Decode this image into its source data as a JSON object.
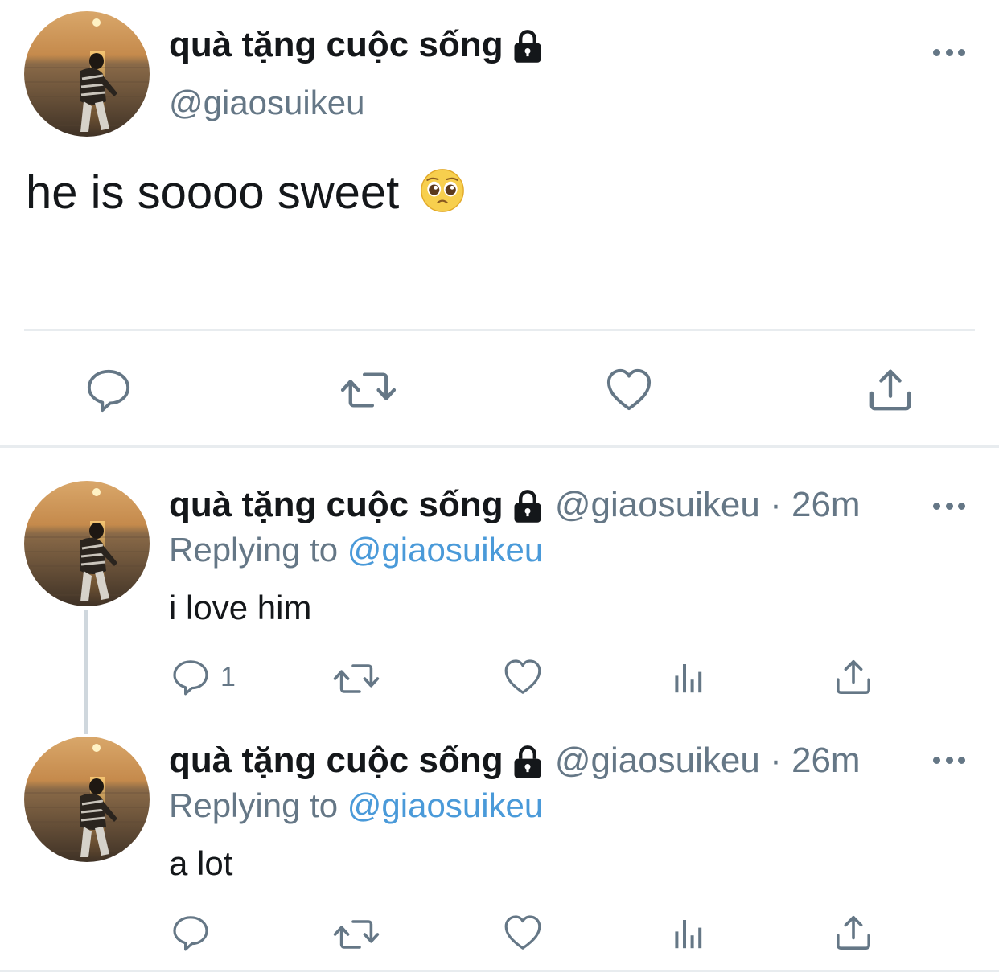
{
  "main_tweet": {
    "display_name": "quà tặng cuộc sống",
    "handle": "@giaosuikeu",
    "text": "he is soooo sweet",
    "emoji": "🥺"
  },
  "replies": [
    {
      "display_name": "quà tặng cuộc sống",
      "handle": "@giaosuikeu",
      "time": "26m",
      "replying_prefix": "Replying to",
      "replying_to": "@giaosuikeu",
      "text": "i love him",
      "reply_count": "1"
    },
    {
      "display_name": "quà tặng cuộc sống",
      "handle": "@giaosuikeu",
      "time": "26m",
      "replying_prefix": "Replying to",
      "replying_to": "@giaosuikeu",
      "text": "a lot",
      "reply_count": ""
    }
  ],
  "icons": [
    "lock-icon",
    "more-icon",
    "reply-icon",
    "retweet-icon",
    "like-icon",
    "analytics-icon",
    "share-icon"
  ],
  "colors": {
    "text": "#14171a",
    "secondary": "#657786",
    "link": "#4a9ad9",
    "divider": "#e8ecef"
  }
}
